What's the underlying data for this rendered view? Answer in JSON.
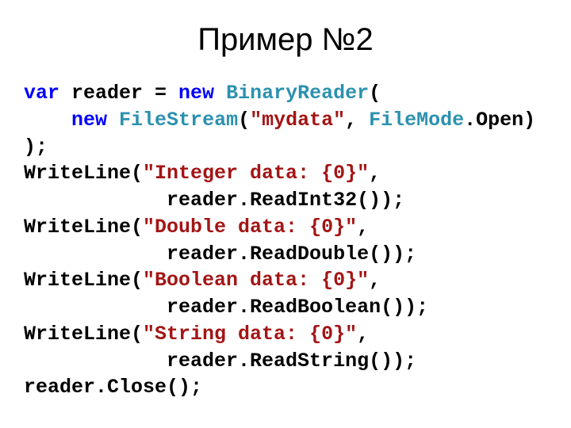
{
  "title": "Пример №2",
  "code": {
    "l1_var": "var",
    "l1_reader": " reader = ",
    "l1_new": "new",
    "l1_sp": " ",
    "l1_type": "BinaryReader",
    "l1_paren": "(",
    "l2_indent": "    ",
    "l2_new": "new",
    "l2_sp": " ",
    "l2_type": "FileStream",
    "l2_paren": "(",
    "l2_str": "\"mydata\"",
    "l2_comma": ", ",
    "l2_enum": "FileMode",
    "l2_open": ".Open)",
    "l3": ");",
    "l4_call": "WriteLine(",
    "l4_str": "\"Integer data: {0}\"",
    "l4_end": ",",
    "l5": "            reader.ReadInt32());",
    "l6_call": "WriteLine(",
    "l6_str": "\"Double data: {0}\"",
    "l6_end": ",",
    "l7": "            reader.ReadDouble());",
    "l8_call": "WriteLine(",
    "l8_str": "\"Boolean data: {0}\"",
    "l8_end": ",",
    "l9": "            reader.ReadBoolean());",
    "l10_call": "WriteLine(",
    "l10_str": "\"String data: {0}\"",
    "l10_end": ",",
    "l11": "            reader.ReadString());",
    "l12": "reader.Close();"
  }
}
